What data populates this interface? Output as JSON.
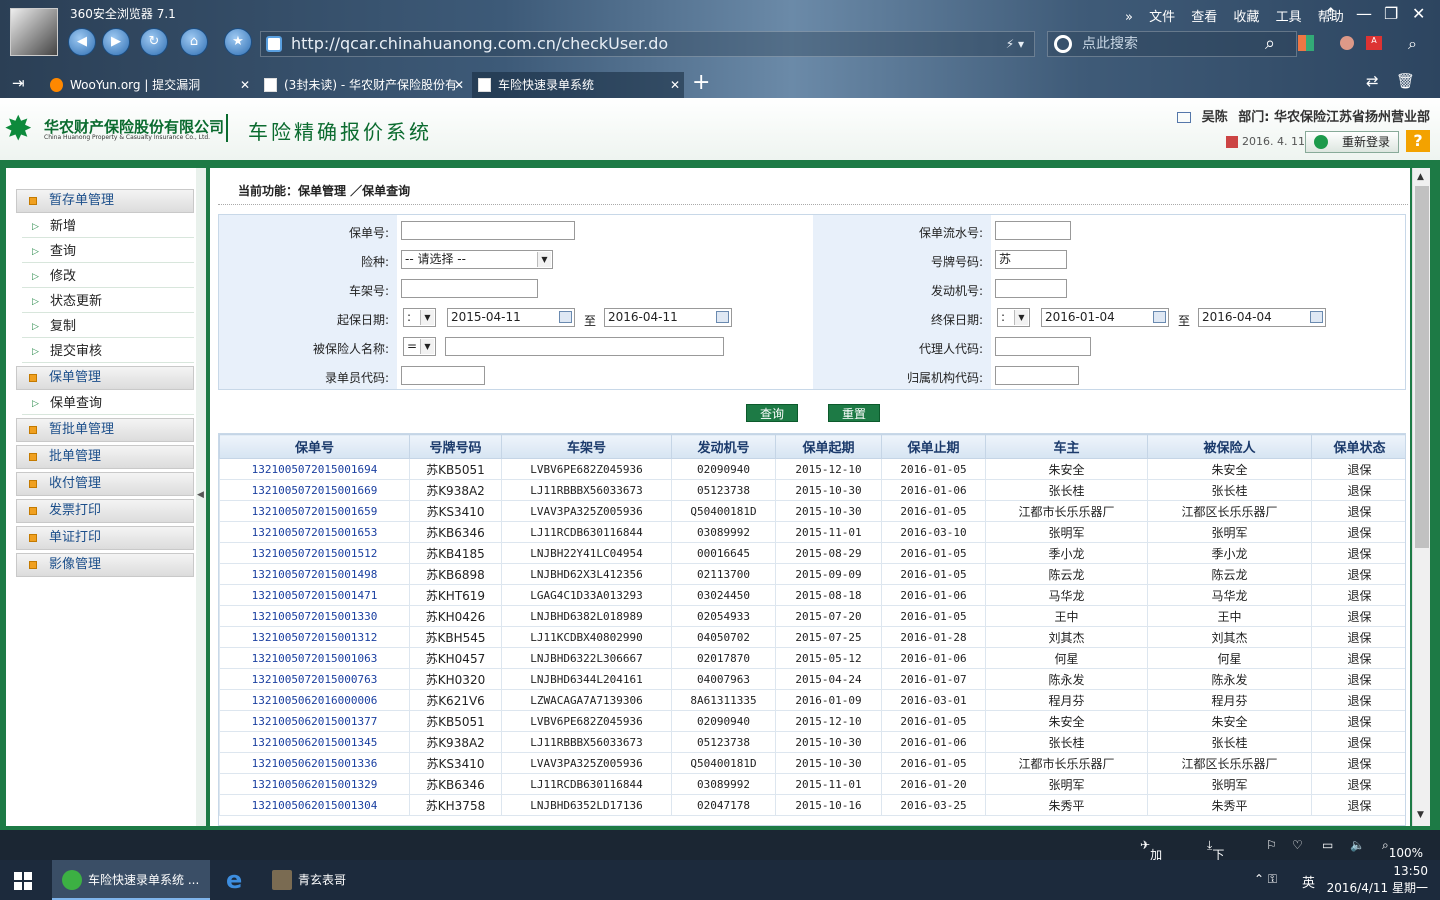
{
  "browser": {
    "app_title": "360安全浏览器 7.1",
    "url": "http://qcar.chinahuanong.com.cn/checkUser.do",
    "search_placeholder": "点此搜索",
    "menu": [
      "文件",
      "查看",
      "收藏",
      "工具",
      "帮助"
    ],
    "tabs": [
      {
        "label": "WooYun.org | 提交漏洞",
        "active": false
      },
      {
        "label": "(3封未读) - 华农财产保险股份有",
        "active": false
      },
      {
        "label": "车险快速录单系统",
        "active": true
      }
    ]
  },
  "header": {
    "company_cn": "华农财产保险股份有限公司",
    "company_en": "China Huanong Property & Casualty Insurance Co., Ltd.",
    "system_name": "车险精确报价系统",
    "user": "吴陈",
    "dept_label": "部门:",
    "dept": "华农保险江苏省扬州营业部",
    "date": "2016. 4. 11",
    "relogin": "重新登录",
    "help": "?"
  },
  "sidebar": {
    "groups": [
      {
        "label": "暂存单管理",
        "items": [
          "新增",
          "查询",
          "修改",
          "状态更新",
          "复制",
          "提交审核"
        ]
      },
      {
        "label": "保单管理",
        "items": [
          "保单查询"
        ]
      },
      {
        "label": "暂批单管理",
        "items": []
      },
      {
        "label": "批单管理",
        "items": []
      },
      {
        "label": "收付管理",
        "items": []
      },
      {
        "label": "发票打印",
        "items": []
      },
      {
        "label": "单证打印",
        "items": []
      },
      {
        "label": "影像管理",
        "items": []
      }
    ]
  },
  "breadcrumb": "当前功能：保单管理 ／保单查询",
  "form": {
    "policy_no": "保单号:",
    "serial_no": "保单流水号:",
    "risk_type": "险种:",
    "risk_type_value": "-- 请选择 --",
    "plate_no": "号牌号码:",
    "plate_no_value": "苏",
    "frame_no": "车架号:",
    "engine_no": "发动机号:",
    "start_date": "起保日期:",
    "start_op": ":",
    "start_from": "2015-04-11",
    "start_to": "2016-04-11",
    "end_date": "终保日期:",
    "end_op": ":",
    "end_from": "2016-01-04",
    "end_to": "2016-04-04",
    "to_label": "至",
    "insured_name": "被保险人名称:",
    "insured_op": "=",
    "agent_code": "代理人代码:",
    "clerk_code": "录单员代码:",
    "org_code": "归属机构代码:",
    "query": "查询",
    "reset": "重置"
  },
  "table": {
    "headers": [
      "保单号",
      "号牌号码",
      "车架号",
      "发动机号",
      "保单起期",
      "保单止期",
      "车主",
      "被保险人",
      "保单状态"
    ],
    "rows": [
      [
        "132100507201500169​4",
        "苏KB5051",
        "LVBV6PE682Z045936",
        "02090940",
        "2015-12-10",
        "2016-01-05",
        "朱安全",
        "朱安全",
        "退保"
      ],
      [
        "132100507201500166​9",
        "苏K938A2",
        "LJ11RBBBX56033673",
        "05123738",
        "2015-10-30",
        "2016-01-06",
        "张长桂",
        "张长桂",
        "退保"
      ],
      [
        "132100507201500165​9",
        "苏KS3410",
        "LVAV3PA325Z005936",
        "Q50400181D",
        "2015-10-30",
        "2016-01-05",
        "江都市长乐乐器厂",
        "江都区长乐乐器厂",
        "退保"
      ],
      [
        "132100507201500165​3",
        "苏KB6346",
        "LJ11RCDB630116844",
        "03089992",
        "2015-11-01",
        "2016-03-10",
        "张明军",
        "张明军",
        "退保"
      ],
      [
        "132100507201500151​2",
        "苏KB4185",
        "LNJBH22Y41LC04954",
        "00016645",
        "2015-08-29",
        "2016-01-05",
        "季小龙",
        "季小龙",
        "退保"
      ],
      [
        "132100507201500149​8",
        "苏KB6898",
        "LNJBHD62X3L412356",
        "02113700",
        "2015-09-09",
        "2016-01-05",
        "陈云龙",
        "陈云龙",
        "退保"
      ],
      [
        "132100507201500147​1",
        "苏KHT619",
        "LGAG4C1D33A013293",
        "03024450",
        "2015-08-18",
        "2016-01-06",
        "马华龙",
        "马华龙",
        "退保"
      ],
      [
        "132100507201500133​0",
        "苏KH0426",
        "LNJBHD6382L018989",
        "02054933",
        "2015-07-20",
        "2016-01-05",
        "王中",
        "王中",
        "退保"
      ],
      [
        "132100507201500131​2",
        "苏KBH545",
        "LJ11KCDBX40802990",
        "04050702",
        "2015-07-25",
        "2016-01-28",
        "刘其杰",
        "刘其杰",
        "退保"
      ],
      [
        "132100507201500106​3",
        "苏KH0457",
        "LNJBHD6322L306667",
        "02017870",
        "2015-05-12",
        "2016-01-06",
        "何星",
        "何星",
        "退保"
      ],
      [
        "132100507201500076​3",
        "苏KH0320",
        "LNJBHD6344L204161",
        "04007963",
        "2015-04-24",
        "2016-01-07",
        "陈永发",
        "陈永发",
        "退保"
      ],
      [
        "132100506201600000​6",
        "苏K621V6",
        "LZWACAGA7A7139306",
        "8A61311335",
        "2016-01-09",
        "2016-03-01",
        "程月芬",
        "程月芬",
        "退保"
      ],
      [
        "132100506201500137​7",
        "苏KB5051",
        "LVBV6PE682Z045936",
        "02090940",
        "2015-12-10",
        "2016-01-05",
        "朱安全",
        "朱安全",
        "退保"
      ],
      [
        "132100506201500134​5",
        "苏K938A2",
        "LJ11RBBBX56033673",
        "05123738",
        "2015-10-30",
        "2016-01-06",
        "张长桂",
        "张长桂",
        "退保"
      ],
      [
        "132100506201500133​6",
        "苏KS3410",
        "LVAV3PA325Z005936",
        "Q50400181D",
        "2015-10-30",
        "2016-01-05",
        "江都市长乐乐器厂",
        "江都区长乐乐器厂",
        "退保"
      ],
      [
        "132100506201500132​9",
        "苏KB6346",
        "LJ11RCDB630116844",
        "03089992",
        "2015-11-01",
        "2016-01-20",
        "张明军",
        "张明军",
        "退保"
      ],
      [
        "132100506201500130​4",
        "苏KH3758",
        "LNJBHD6352LD17136",
        "02047178",
        "2015-10-16",
        "2016-03-25",
        "朱秀平",
        "朱秀平",
        "退保"
      ]
    ]
  },
  "statusbar": {
    "accelerator": "加速器",
    "download": "下载",
    "zoom": "100%"
  },
  "taskbar": {
    "tasks": [
      "车险快速录单系统 ...",
      "",
      "青玄表哥"
    ],
    "ime": "英",
    "time": "13:50",
    "date": "2016/4/11 星期一"
  }
}
